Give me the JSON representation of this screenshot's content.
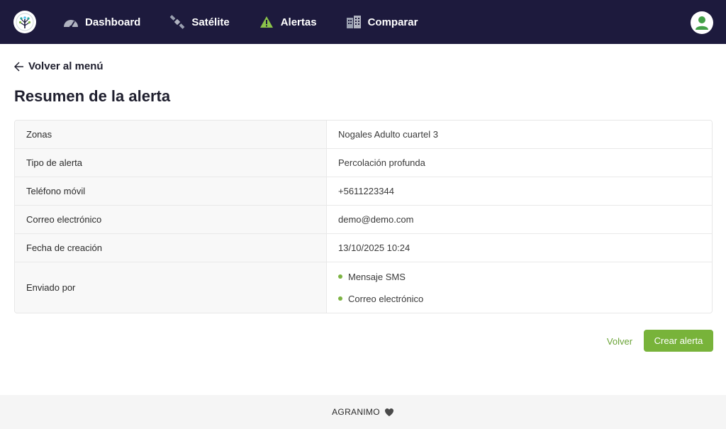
{
  "navbar": {
    "logo_icon": "tree-logo-icon",
    "items": [
      {
        "label": "Dashboard",
        "icon": "gauge-icon"
      },
      {
        "label": "Satélite",
        "icon": "satellite-icon"
      },
      {
        "label": "Alertas",
        "icon": "warning-icon"
      },
      {
        "label": "Comparar",
        "icon": "buildings-icon"
      }
    ],
    "avatar_icon": "user-icon"
  },
  "back_link": {
    "label": "Volver al menú",
    "icon": "arrow-left-icon"
  },
  "page_title": "Resumen de la alerta",
  "summary": {
    "rows": [
      {
        "label": "Zonas",
        "value": "Nogales Adulto cuartel 3"
      },
      {
        "label": "Tipo de alerta",
        "value": "Percolación profunda"
      },
      {
        "label": "Teléfono móvil",
        "value": "+5611223344"
      },
      {
        "label": "Correo electrónico",
        "value": "demo@demo.com"
      },
      {
        "label": "Fecha de creación",
        "value": "13/10/2025 10:24"
      }
    ],
    "sent_by": {
      "label": "Enviado por",
      "items": [
        "Mensaje SMS",
        "Correo electrónico"
      ]
    }
  },
  "actions": {
    "back_label": "Volver",
    "create_label": "Crear alerta"
  },
  "footer": {
    "brand": "AGRANIMO",
    "icon": "heart-icon"
  },
  "colors": {
    "navbar_bg": "#1d1a3d",
    "accent_green": "#78b33a",
    "warning_yellow": "#8bc34a"
  }
}
